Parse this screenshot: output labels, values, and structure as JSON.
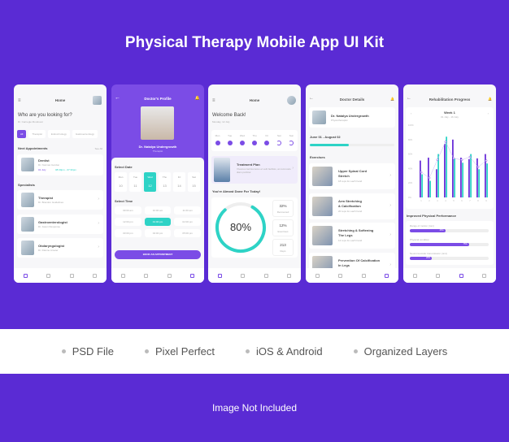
{
  "title": "Physical Therapy Mobile App UI Kit",
  "features": [
    "PSD File",
    "Pixel Perfect",
    "iOS & Android",
    "Organized Layers"
  ],
  "footer": "Image Not Included",
  "colors": {
    "background": "#5a2bd4",
    "accent": "#7b4ce6",
    "teal": "#2ed3c6"
  },
  "home": {
    "title": "Home",
    "heading": "Who are you looking for?",
    "subtitle": "Dr. Carnegie Mondover",
    "chips": [
      "All",
      "Therapist",
      "Endocrinology",
      "Gastroenterology"
    ],
    "next_label": "Next Appointments",
    "see_all": "See All",
    "appointment": {
      "type": "Dentist",
      "doctor": "Dr. Norman Gordon",
      "date": "01 July",
      "time": "08:30pm - 07:30pm"
    },
    "specialists_label": "Specialists",
    "specialists": [
      {
        "type": "Therapist",
        "doctor": "Dr. Brandon Guidelines"
      },
      {
        "type": "Gastroenterologist",
        "doctor": "Dr. Jason Response"
      },
      {
        "type": "Otolaryngologist",
        "doctor": "Dr. Dianne Ameter"
      }
    ]
  },
  "profile": {
    "title": "Doctor's Profile",
    "name": "Dr. Natalya Undergrowth",
    "role": "Therapist",
    "select_date": "Select Date",
    "dates": [
      {
        "d": "Mon",
        "n": "10"
      },
      {
        "d": "Tue",
        "n": "11"
      },
      {
        "d": "Wed",
        "n": "12"
      },
      {
        "d": "Thu",
        "n": "13"
      },
      {
        "d": "Fri",
        "n": "14"
      },
      {
        "d": "Sat",
        "n": "15"
      }
    ],
    "select_time": "Select Time",
    "times": [
      "09:00 am",
      "10:00 am",
      "11:00 am",
      "12:00 pm",
      "01:00 pm",
      "02:00 pm",
      "03:00 pm",
      "04:00 pm",
      "05:00 pm"
    ],
    "book": "BOOK AN APPOINTMENT"
  },
  "dashboard": {
    "title": "Home",
    "welcome": "Welcome Back!",
    "date": "Monday, 12 July",
    "days": [
      "Mon",
      "Tue",
      "Wed",
      "Thu",
      "Fri",
      "Sat",
      "Sun"
    ],
    "plan_title": "Treatment Plan",
    "plan_text": "Vivamus lacinia lacus et velit facilisis, at commodo diam porttitor.",
    "almost": "You're Almost Done For Today!",
    "progress": "80%",
    "progress_value": 80,
    "stats": [
      {
        "v": "32%",
        "l": "Recovered"
      },
      {
        "v": "12%",
        "l": "Exercises"
      },
      {
        "v": "213",
        "l": "Reps"
      }
    ]
  },
  "details": {
    "title": "Doctor Details",
    "name": "Dr. Natalya Undergrowth",
    "role": "Physiotherapist",
    "range": "June 01 - August 02",
    "range_progress": 46,
    "exercises_label": "Exercises",
    "exercises": [
      {
        "t1": "Upper Spinal Cord",
        "t2": "Stretch",
        "r": "18 reps for each hand"
      },
      {
        "t1": "Arm Stretching",
        "t2": "& Calcification",
        "r": "20 reps for each hand"
      },
      {
        "t1": "Stretching & Softening",
        "t2": "The Legs",
        "r": "12 reps for each hand"
      },
      {
        "t1": "Prevention Of Calcification",
        "t2": "In Legs",
        "r": ""
      }
    ]
  },
  "rehab": {
    "title": "Rehabilitation Progress",
    "week": "Week 1",
    "week_range": "01 July - 16 July",
    "perf_label": "Improved Physical Performance",
    "metrics": [
      {
        "l": "Range of motion (rom)",
        "v": "45%",
        "p": 45
      },
      {
        "l": "Physical condition",
        "v": "75%",
        "p": 75
      },
      {
        "l": "Neuromuscular transmission (nmt)",
        "v": "28%",
        "p": 28
      }
    ]
  },
  "chart_data": {
    "type": "bar",
    "categories": [
      "1",
      "2",
      "3",
      "4",
      "5",
      "6",
      "7",
      "8",
      "9"
    ],
    "yticks": [
      "100%",
      "80%",
      "60%",
      "40%",
      "20%",
      "0%"
    ],
    "ylim": [
      0,
      100
    ],
    "series": [
      {
        "values": [
          51,
          55,
          39,
          74,
          80,
          55,
          53,
          54,
          60
        ],
        "color": "#6a2fd8"
      },
      {
        "values": [
          32,
          23,
          60,
          84,
          54,
          48,
          60,
          39,
          47
        ],
        "color": "#2ed3c6"
      }
    ],
    "line": [
      35,
      27,
      52,
      77,
      54,
      52,
      56,
      42,
      51
    ]
  }
}
